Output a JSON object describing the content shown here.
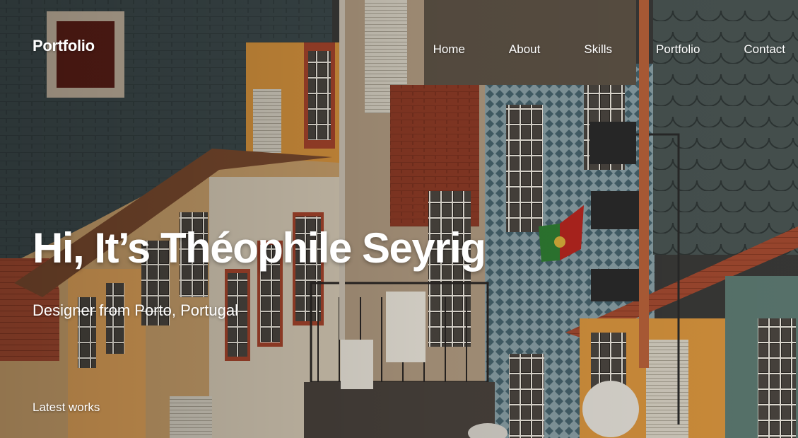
{
  "header": {
    "logo": "Portfolio",
    "nav": [
      "Home",
      "About",
      "Skills",
      "Portfolio",
      "Contact"
    ]
  },
  "hero": {
    "title": "Hi, It’s Théophile Seyrig",
    "subtitle": "Designer from Porto, Portugal",
    "latest_works": "Latest works"
  },
  "colors": {
    "text": "#ffffff",
    "tile_blue": "#3f5a66",
    "ochre": "#d9953e",
    "terracotta": "#a8452c",
    "cream": "#c9b9a0"
  }
}
